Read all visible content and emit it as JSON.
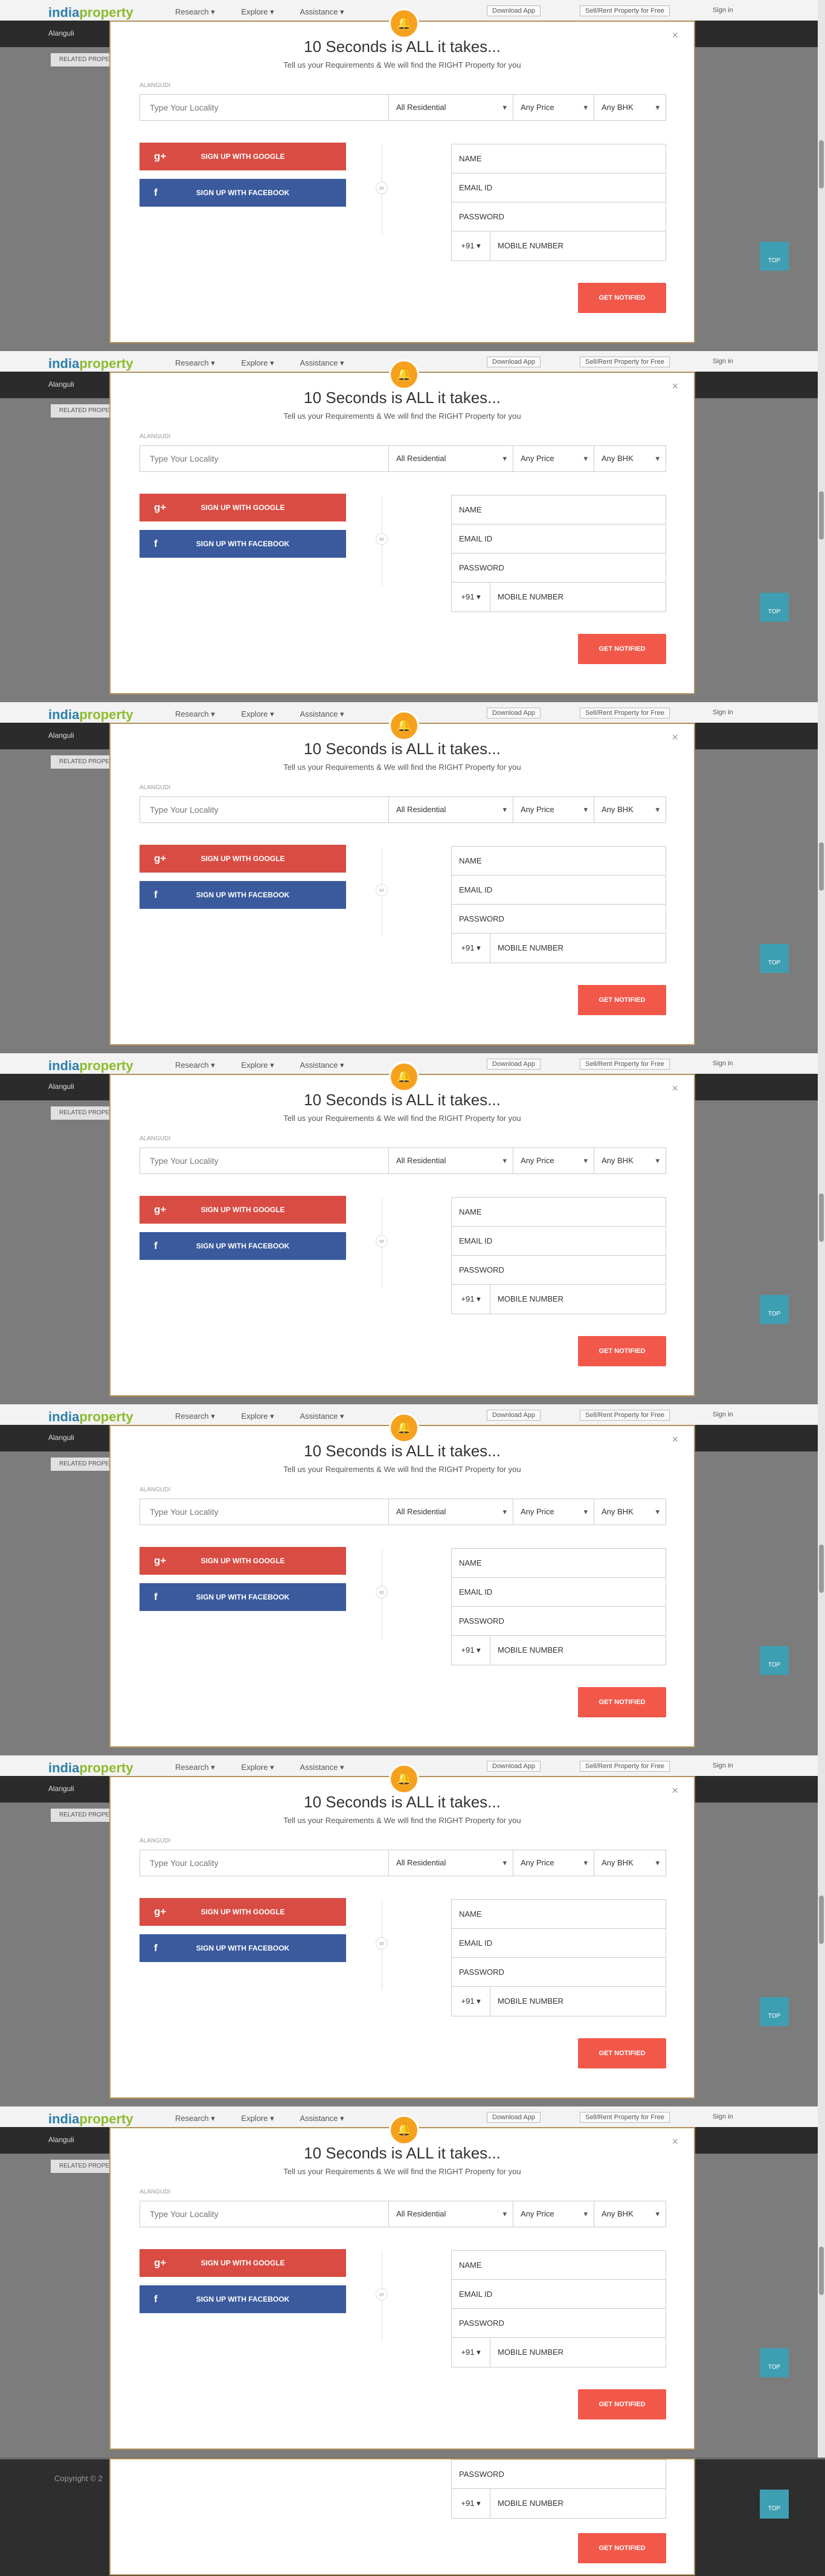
{
  "header": {
    "logo_part1": "india",
    "logo_part2": "property",
    "nav": [
      "Research ▾",
      "Explore ▾",
      "Assistance ▾"
    ],
    "download_app": "Download App",
    "sell_rent": "Sell/Rent Property for Free",
    "sign_in": "Sign in",
    "location": "Alanguli"
  },
  "sidebar": {
    "related_label": "RELATED PROPE"
  },
  "top_button_label": "TOP",
  "modal": {
    "title": "10 Seconds is ALL it takes...",
    "subtitle": "Tell us your Requirements & We will find the RIGHT Property for you",
    "locality_label": "ALANGUDI",
    "locality_placeholder": "Type Your Locality",
    "property_type": "All Residential",
    "price": "Any Price",
    "bhk": "Any BHK",
    "google_label": "SIGN UP WITH GOOGLE",
    "facebook_label": "SIGN UP WITH FACEBOOK",
    "or_label": "or",
    "name_placeholder": "NAME",
    "email_placeholder": "EMAIL ID",
    "password_placeholder": "PASSWORD",
    "country_code": "+91",
    "mobile_placeholder": "MOBILE NUMBER",
    "submit_label": "GET NOTIFIED",
    "close": "×"
  },
  "footer": {
    "copyright": "Copyright © 2"
  }
}
